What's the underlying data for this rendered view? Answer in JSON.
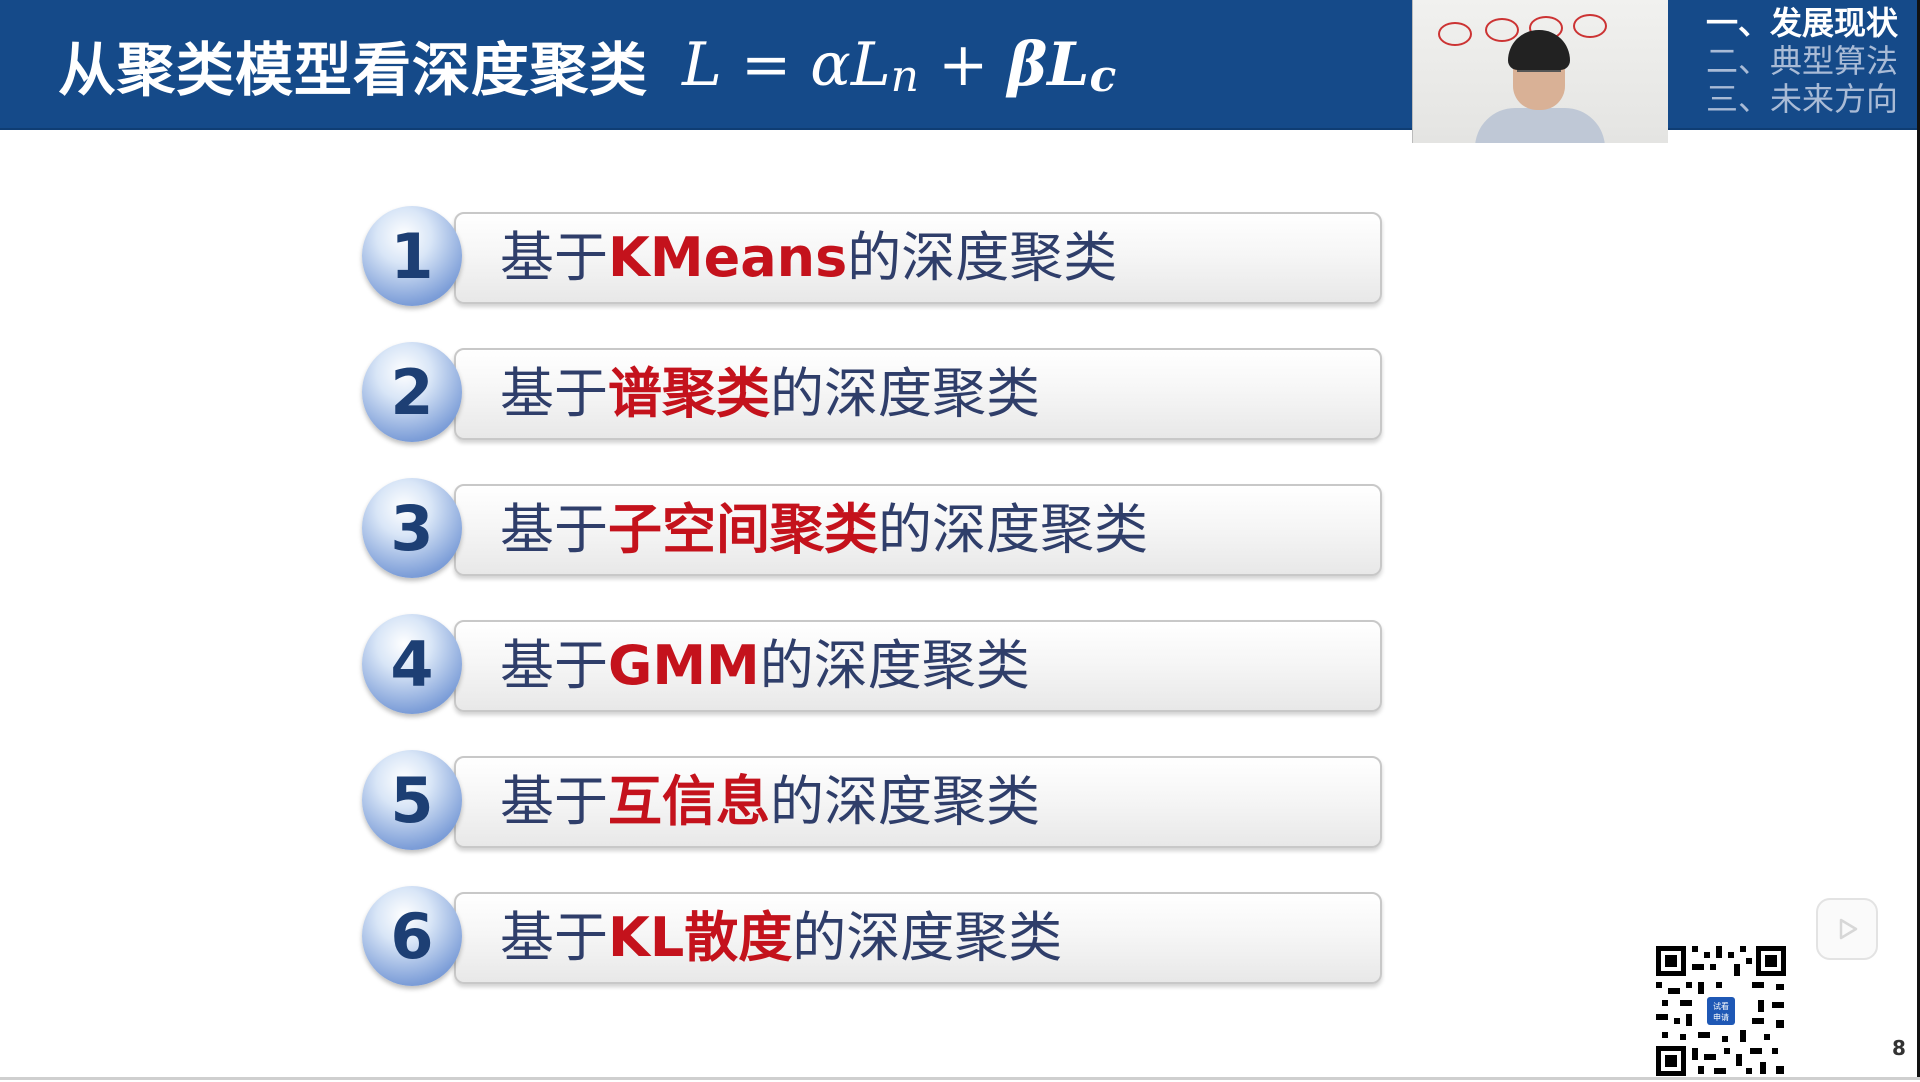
{
  "header": {
    "title": "从聚类模型看深度聚类",
    "formula": {
      "L": "L",
      "eq": "=",
      "alpha": "α",
      "Ln": "L",
      "n": "n",
      "plus": "+",
      "beta": "β",
      "Lc": "L",
      "c": "c"
    },
    "outline": [
      {
        "label": "一、发展现状",
        "active": true
      },
      {
        "label": "二、典型算法",
        "active": false
      },
      {
        "label": "三、未来方向",
        "active": false
      }
    ]
  },
  "items": [
    {
      "number": "1",
      "prefix": "基于",
      "highlight": "KMeans",
      "suffix": "的深度聚类"
    },
    {
      "number": "2",
      "prefix": "基于",
      "highlight": "谱聚类",
      "suffix": "的深度聚类"
    },
    {
      "number": "3",
      "prefix": "基于",
      "highlight": "子空间聚类",
      "suffix": "的深度聚类"
    },
    {
      "number": "4",
      "prefix": "基于",
      "highlight": "GMM",
      "suffix": "的深度聚类"
    },
    {
      "number": "5",
      "prefix": "基于",
      "highlight": "互信息",
      "suffix": "的深度聚类"
    },
    {
      "number": "6",
      "prefix": "基于",
      "highlight": "KL散度",
      "suffix": "的深度聚类"
    }
  ],
  "qr_badge": "试看 申请",
  "page_number": "8",
  "colors": {
    "header_bg": "#154a89",
    "highlight": "#c4121c",
    "label_text": "#2f3e6a",
    "number_text": "#1d3f74"
  },
  "icons": {
    "play": "play-icon",
    "qr": "qr-code-icon"
  }
}
